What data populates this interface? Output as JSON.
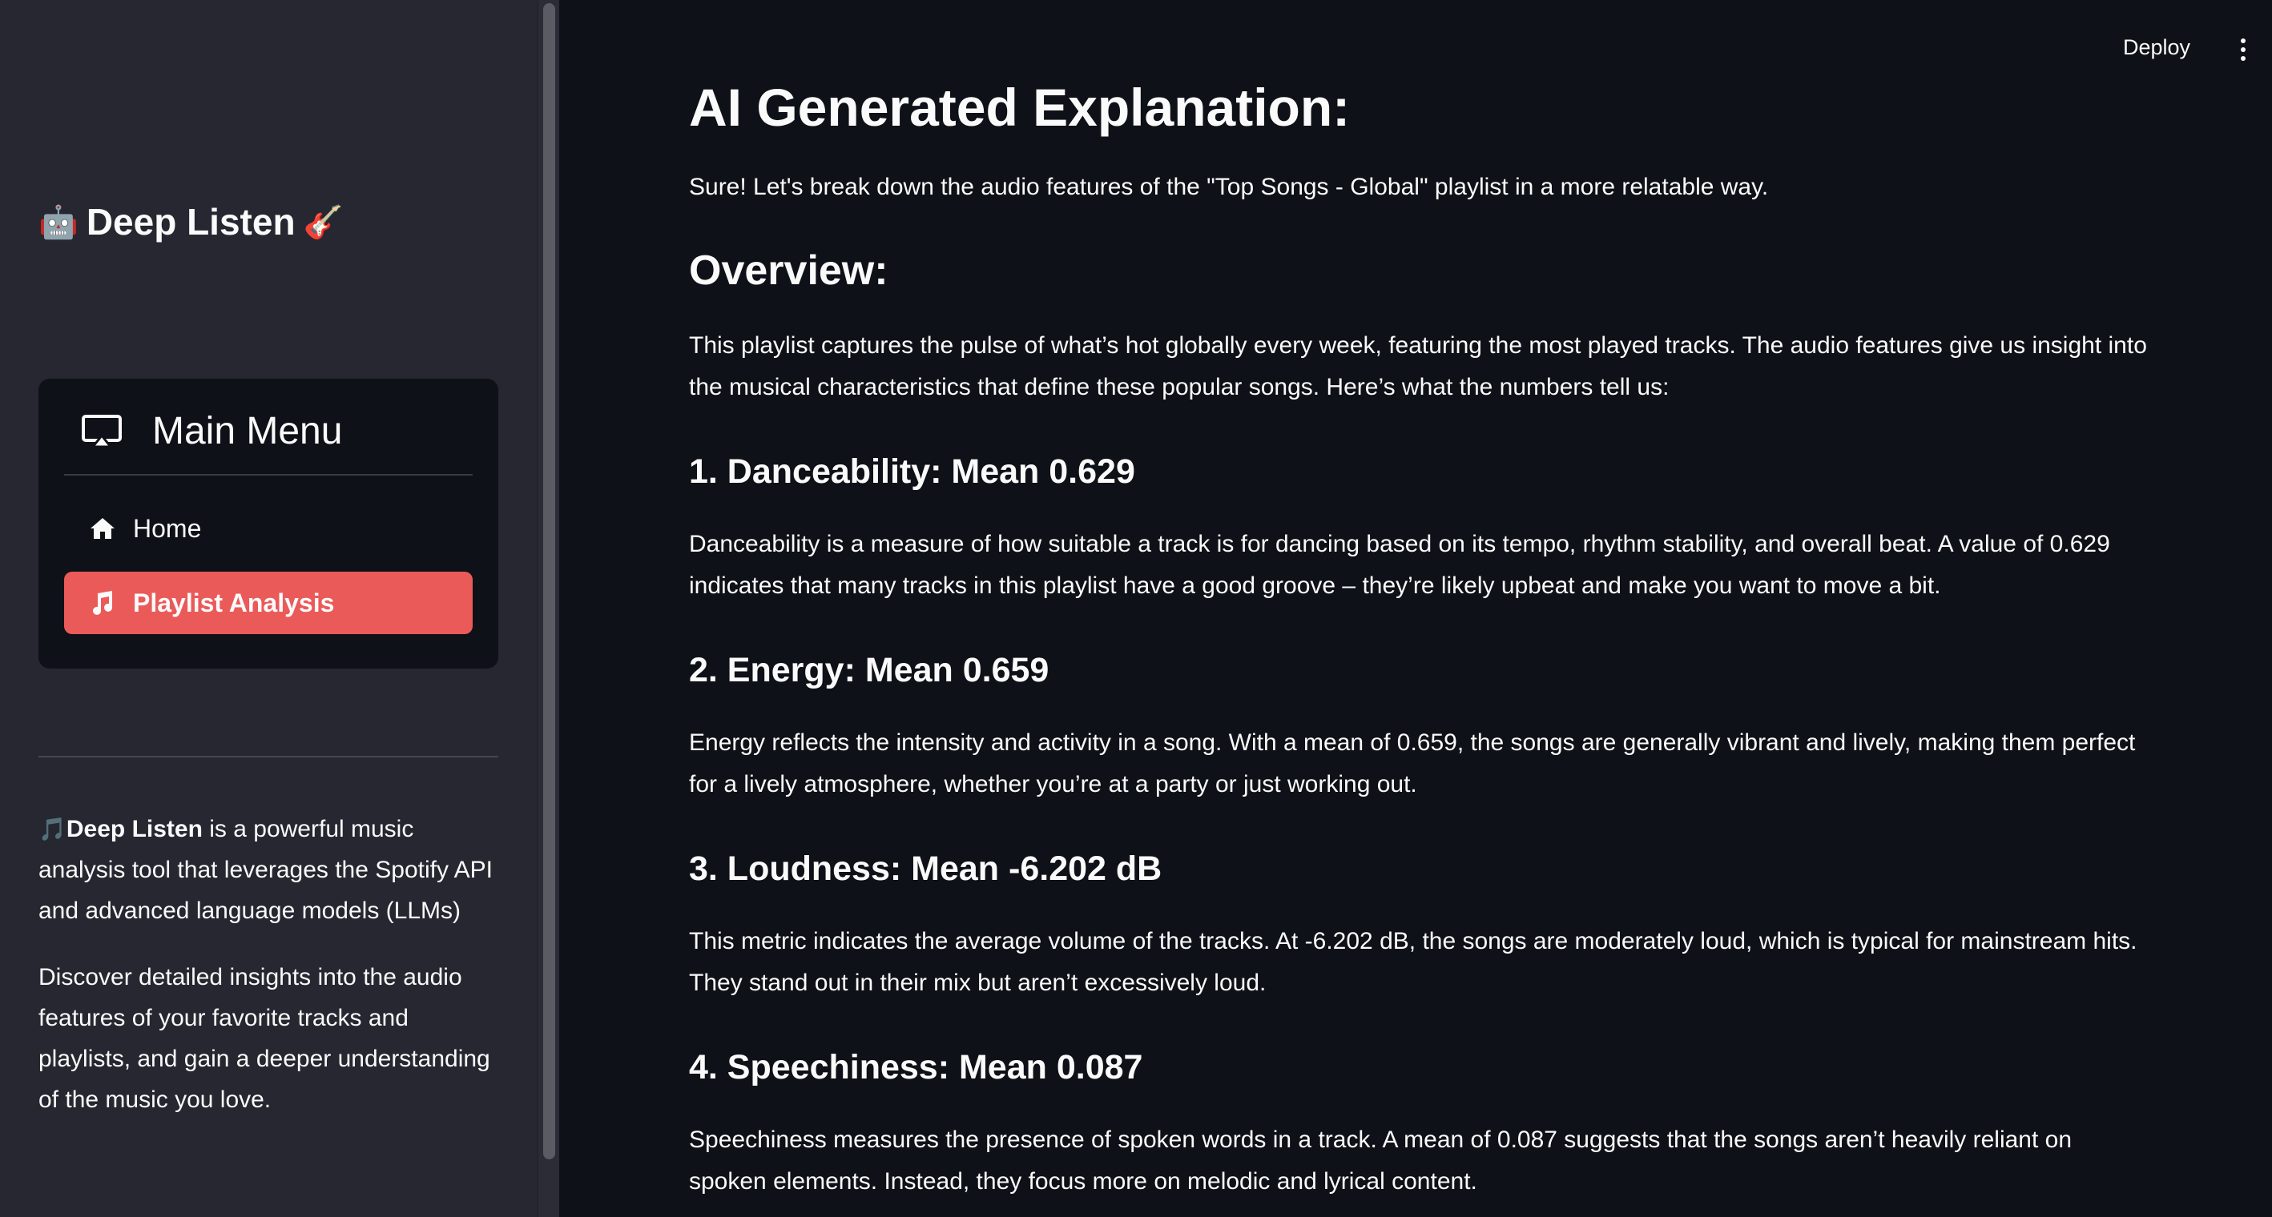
{
  "sidebar": {
    "app_title": "Deep Listen",
    "title_emoji_left": "🤖",
    "title_emoji_right": "🎸",
    "menu": {
      "title": "Main Menu",
      "header_icon": "airplay-icon",
      "items": [
        {
          "label": "Home",
          "icon": "house-icon",
          "active": false
        },
        {
          "label": "Playlist Analysis",
          "icon": "music-note-icon",
          "active": true
        }
      ]
    },
    "about": {
      "note_emoji": "🎵",
      "brand": "Deep Listen",
      "p1_rest": " is a powerful music analysis tool that leverages the Spotify API and advanced language models (LLMs)",
      "p2": "Discover detailed insights into the audio features of your favorite tracks and playlists, and gain a deeper understanding of the music you love."
    }
  },
  "header": {
    "deploy_label": "Deploy",
    "menu_icon": "kebab-menu-icon"
  },
  "main": {
    "title": "AI Generated Explanation:",
    "intro": "Sure! Let's break down the audio features of the \"Top Songs - Global\" playlist in a more relatable way.",
    "overview_heading": "Overview:",
    "overview_text": "This playlist captures the pulse of what’s hot globally every week, featuring the most played tracks. The audio features give us insight into the musical characteristics that define these popular songs. Here’s what the numbers tell us:",
    "sections": [
      {
        "heading": "1. Danceability: Mean 0.629",
        "text": "Danceability is a measure of how suitable a track is for dancing based on its tempo, rhythm stability, and overall beat. A value of 0.629 indicates that many tracks in this playlist have a good groove – they’re likely upbeat and make you want to move a bit."
      },
      {
        "heading": "2. Energy: Mean 0.659",
        "text": "Energy reflects the intensity and activity in a song. With a mean of 0.659, the songs are generally vibrant and lively, making them perfect for a lively atmosphere, whether you’re at a party or just working out."
      },
      {
        "heading": "3. Loudness: Mean -6.202 dB",
        "text": "This metric indicates the average volume of the tracks. At -6.202 dB, the songs are moderately loud, which is typical for mainstream hits. They stand out in their mix but aren’t excessively loud."
      },
      {
        "heading": "4. Speechiness: Mean 0.087",
        "text": "Speechiness measures the presence of spoken words in a track. A mean of 0.087 suggests that the songs aren’t heavily reliant on spoken elements. Instead, they focus more on melodic and lyrical content."
      }
    ]
  },
  "colors": {
    "background": "#0e1117",
    "sidebar": "#262730",
    "accent": "#ea5a59",
    "text": "#fafafa"
  }
}
